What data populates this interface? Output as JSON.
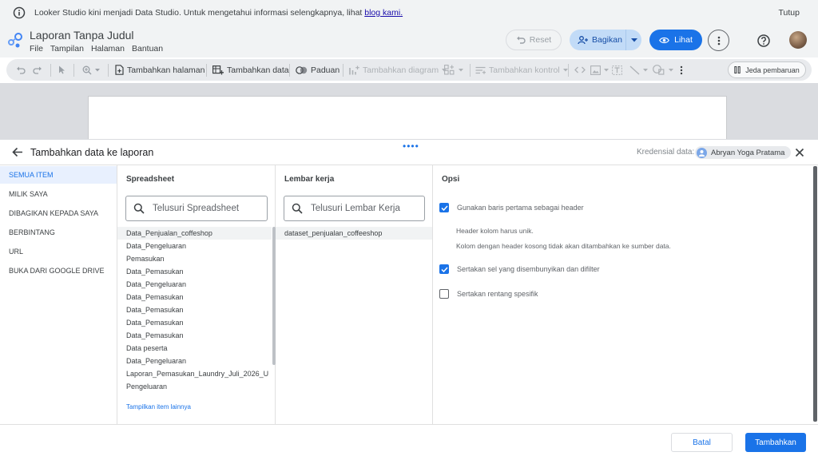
{
  "notice": {
    "message": "Looker Studio kini menjadi Data Studio. Untuk mengetahui informasi selengkapnya, lihat ",
    "link": "blog kami.",
    "close": "Tutup"
  },
  "header": {
    "title": "Laporan Tanpa Judul",
    "menus": [
      "File",
      "Tampilan",
      "Halaman",
      "Bantuan"
    ],
    "reset": "Reset",
    "share": "Bagikan",
    "view": "Lihat"
  },
  "toolbar": {
    "add_page": "Tambahkan halaman",
    "add_data": "Tambahkan data",
    "blend": "Paduan",
    "add_chart": "Tambahkan diagram",
    "add_control": "Tambahkan kontrol",
    "pause": "Jeda pembaruan"
  },
  "panel": {
    "title": "Tambahkan data ke laporan",
    "credential_label": "Kredensial data:",
    "credential_user": "Abryan Yoga Pratama",
    "nav": [
      "SEMUA ITEM",
      "MILIK SAYA",
      "DIBAGIKAN KEPADA SAYA",
      "BERBINTANG",
      "URL",
      "BUKA DARI GOOGLE DRIVE"
    ],
    "spreadsheet": {
      "heading": "Spreadsheet",
      "placeholder": "Telusuri Spreadsheet",
      "items": [
        "Data_Penjualan_coffeshop",
        "Data_Pengeluaran",
        "Pemasukan",
        "Data_Pemasukan",
        "Data_Pengeluaran",
        "Data_Pemasukan",
        "Data_Pemasukan",
        "Data_Pemasukan",
        "Data_Pemasukan",
        "Data peserta",
        "Data_Pengeluaran",
        "Laporan_Pemasukan_Laundry_Juli_2026_U...",
        "Pengeluaran"
      ],
      "more": "Tampilkan item lainnya"
    },
    "worksheet": {
      "heading": "Lembar kerja",
      "placeholder": "Telusuri Lembar Kerja",
      "items": [
        "dataset_penjualan_coffeeshop"
      ]
    },
    "options": {
      "heading": "Opsi",
      "opt1": "Gunakan baris pertama sebagai header",
      "note1": "Header kolom harus unik.",
      "note2": "Kolom dengan header kosong tidak akan ditambahkan ke sumber data.",
      "opt2": "Sertakan sel yang disembunyikan dan difilter",
      "opt3": "Sertakan rentang spesifik"
    },
    "cancel": "Batal",
    "add": "Tambahkan"
  }
}
